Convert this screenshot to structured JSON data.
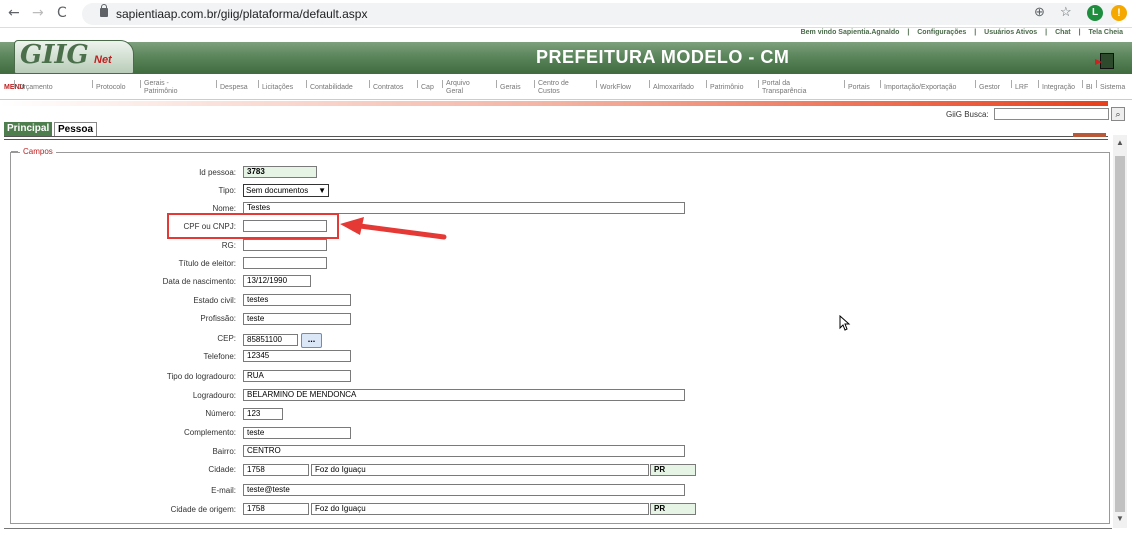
{
  "browser": {
    "url": "sapientiaap.com.br/giig/plataforma/default.aspx",
    "back": "←",
    "forward": "→",
    "reload": "C",
    "zoom": "⊕",
    "star": "☆",
    "profile_initial": "L",
    "warning": "!"
  },
  "header": {
    "top_links": [
      "Bem vindo Sapientia.Agnaldo",
      "|",
      "Configurações",
      "|",
      "Usuários Ativos",
      "|",
      "Chat",
      "|",
      "Tela Cheia"
    ],
    "logo": "GIIG",
    "logo_suffix": "Net",
    "title": "PREFEITURA MODELO - CM"
  },
  "menu": {
    "label": "MENU",
    "items": [
      {
        "label": "Orçamento",
        "two": false
      },
      {
        "label": "Protocolo",
        "two": false
      },
      {
        "label": "Gerais -\nPatrimônio",
        "two": true
      },
      {
        "label": "Despesa",
        "two": false
      },
      {
        "label": "Licitações",
        "two": false
      },
      {
        "label": "Contabilidade",
        "two": false
      },
      {
        "label": "Contratos",
        "two": false
      },
      {
        "label": "Cap",
        "two": false
      },
      {
        "label": "Arquivo\nGeral",
        "two": true
      },
      {
        "label": "Gerais",
        "two": false
      },
      {
        "label": "Centro de\nCustos",
        "two": true
      },
      {
        "label": "WorkFlow",
        "two": false
      },
      {
        "label": "Almoxarifado",
        "two": false
      },
      {
        "label": "Patrimônio",
        "two": false
      },
      {
        "label": "Portal da\nTransparência",
        "two": true
      },
      {
        "label": "Portais",
        "two": false
      },
      {
        "label": "Importação/Exportação",
        "two": false
      },
      {
        "label": "Gestor",
        "two": false
      },
      {
        "label": "LRF",
        "two": false
      },
      {
        "label": "Integração",
        "two": false
      },
      {
        "label": "BI",
        "two": false
      },
      {
        "label": "Sistema",
        "two": false
      }
    ],
    "search_label": "GiiG Busca:",
    "search_value": ""
  },
  "tabs": {
    "principal": "Principal",
    "pessoa": "Pessoa"
  },
  "form": {
    "legend": "Campos",
    "fields": {
      "id_pessoa": {
        "label": "Id pessoa:",
        "value": "3783"
      },
      "tipo": {
        "label": "Tipo:",
        "value": "Sem documentos"
      },
      "nome": {
        "label": "Nome:",
        "value": "Testes"
      },
      "cpf_cnpj": {
        "label": "CPF ou CNPJ:",
        "value": ""
      },
      "rg": {
        "label": "RG:",
        "value": ""
      },
      "titulo_eleitor": {
        "label": "Título de eleitor:",
        "value": ""
      },
      "data_nascimento": {
        "label": "Data de nascimento:",
        "value": "13/12/1990"
      },
      "estado_civil": {
        "label": "Estado civil:",
        "value": "testes"
      },
      "profissao": {
        "label": "Profissão:",
        "value": "teste"
      },
      "cep": {
        "label": "CEP:",
        "value": "85851100",
        "button": "..."
      },
      "telefone": {
        "label": "Telefone:",
        "value": "12345"
      },
      "tipo_logradouro": {
        "label": "Tipo do logradouro:",
        "value": "RUA"
      },
      "logradouro": {
        "label": "Logradouro:",
        "value": "BELARMINO DE MENDONCA"
      },
      "numero": {
        "label": "Número:",
        "value": "123"
      },
      "complemento": {
        "label": "Complemento:",
        "value": "teste"
      },
      "bairro": {
        "label": "Bairro:",
        "value": "CENTRO"
      },
      "cidade": {
        "label": "Cidade:",
        "code": "1758",
        "name": "Foz do Iguaçu",
        "uf": "PR"
      },
      "email": {
        "label": "E-mail:",
        "value": "teste@teste"
      },
      "cidade_origem": {
        "label": "Cidade de origem:",
        "code": "1758",
        "name": "Foz do Iguaçu",
        "uf": "PR"
      }
    }
  },
  "colors": {
    "brand_green": "#4e7e4e",
    "highlight_red": "#e53935",
    "legend_red": "#c02020"
  }
}
